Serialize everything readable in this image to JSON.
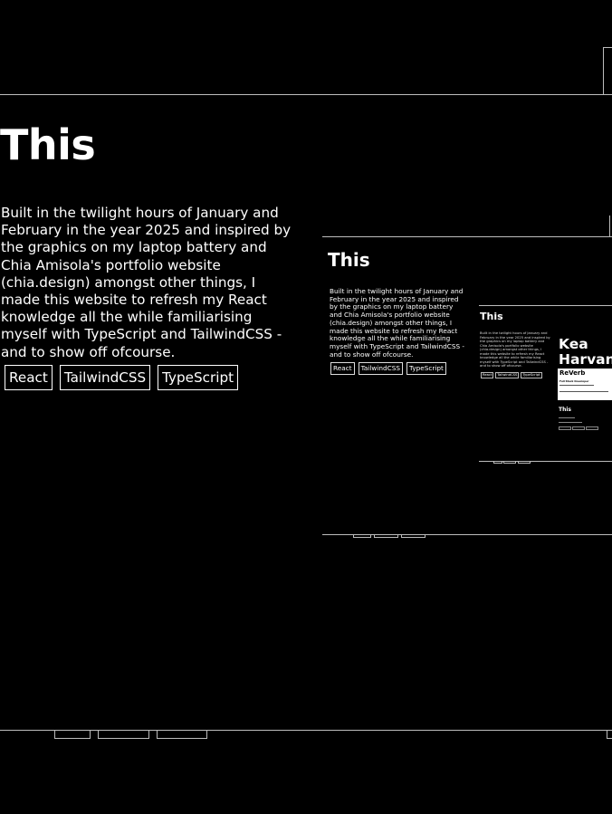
{
  "project": {
    "title": "This",
    "description": "Built in the twilight hours of January and February in the year 2025 and inspired by the graphics on my laptop battery and Chia Amisola's portfolio website (chia.design) amongst other things, I made this website to refresh my React knowledge all the while familiarising myself with TypeScript and TailwindCSS - and to show off ofcourse.",
    "tags": [
      "React",
      "TailwindCSS",
      "TypeScript"
    ]
  },
  "preview": {
    "title": "This",
    "description": "Built in the twilight hours of January and February in the year 2025 and inspired by the graphics on my laptop battery and Chia Amisola's portfolio website (chia.design) amongst other things, I made this website to refresh my React knowledge all the while familiarising myself with TypeScript and TailwindCSS - and to show off ofcourse.",
    "tags": [
      "React",
      "TailwindCSS",
      "TypeScript"
    ],
    "nested": {
      "title": "This",
      "description": "Built in the twilight hours of January and February in the year 2025 and inspired by the graphics on my laptop battery and Chia Amisola's portfolio website (chia.design) amongst other things, I made this website to refresh my React knowledge all the while familiarising myself with TypeScript and TailwindCSS - and to show off ofcourse.",
      "tags": [
        "React",
        "TailwindCSS",
        "TypeScript"
      ],
      "name": "Kea Harvan",
      "card_title": "ReVerb",
      "card_subtitle": "Full Stack Developer",
      "mini_title": "This"
    }
  }
}
